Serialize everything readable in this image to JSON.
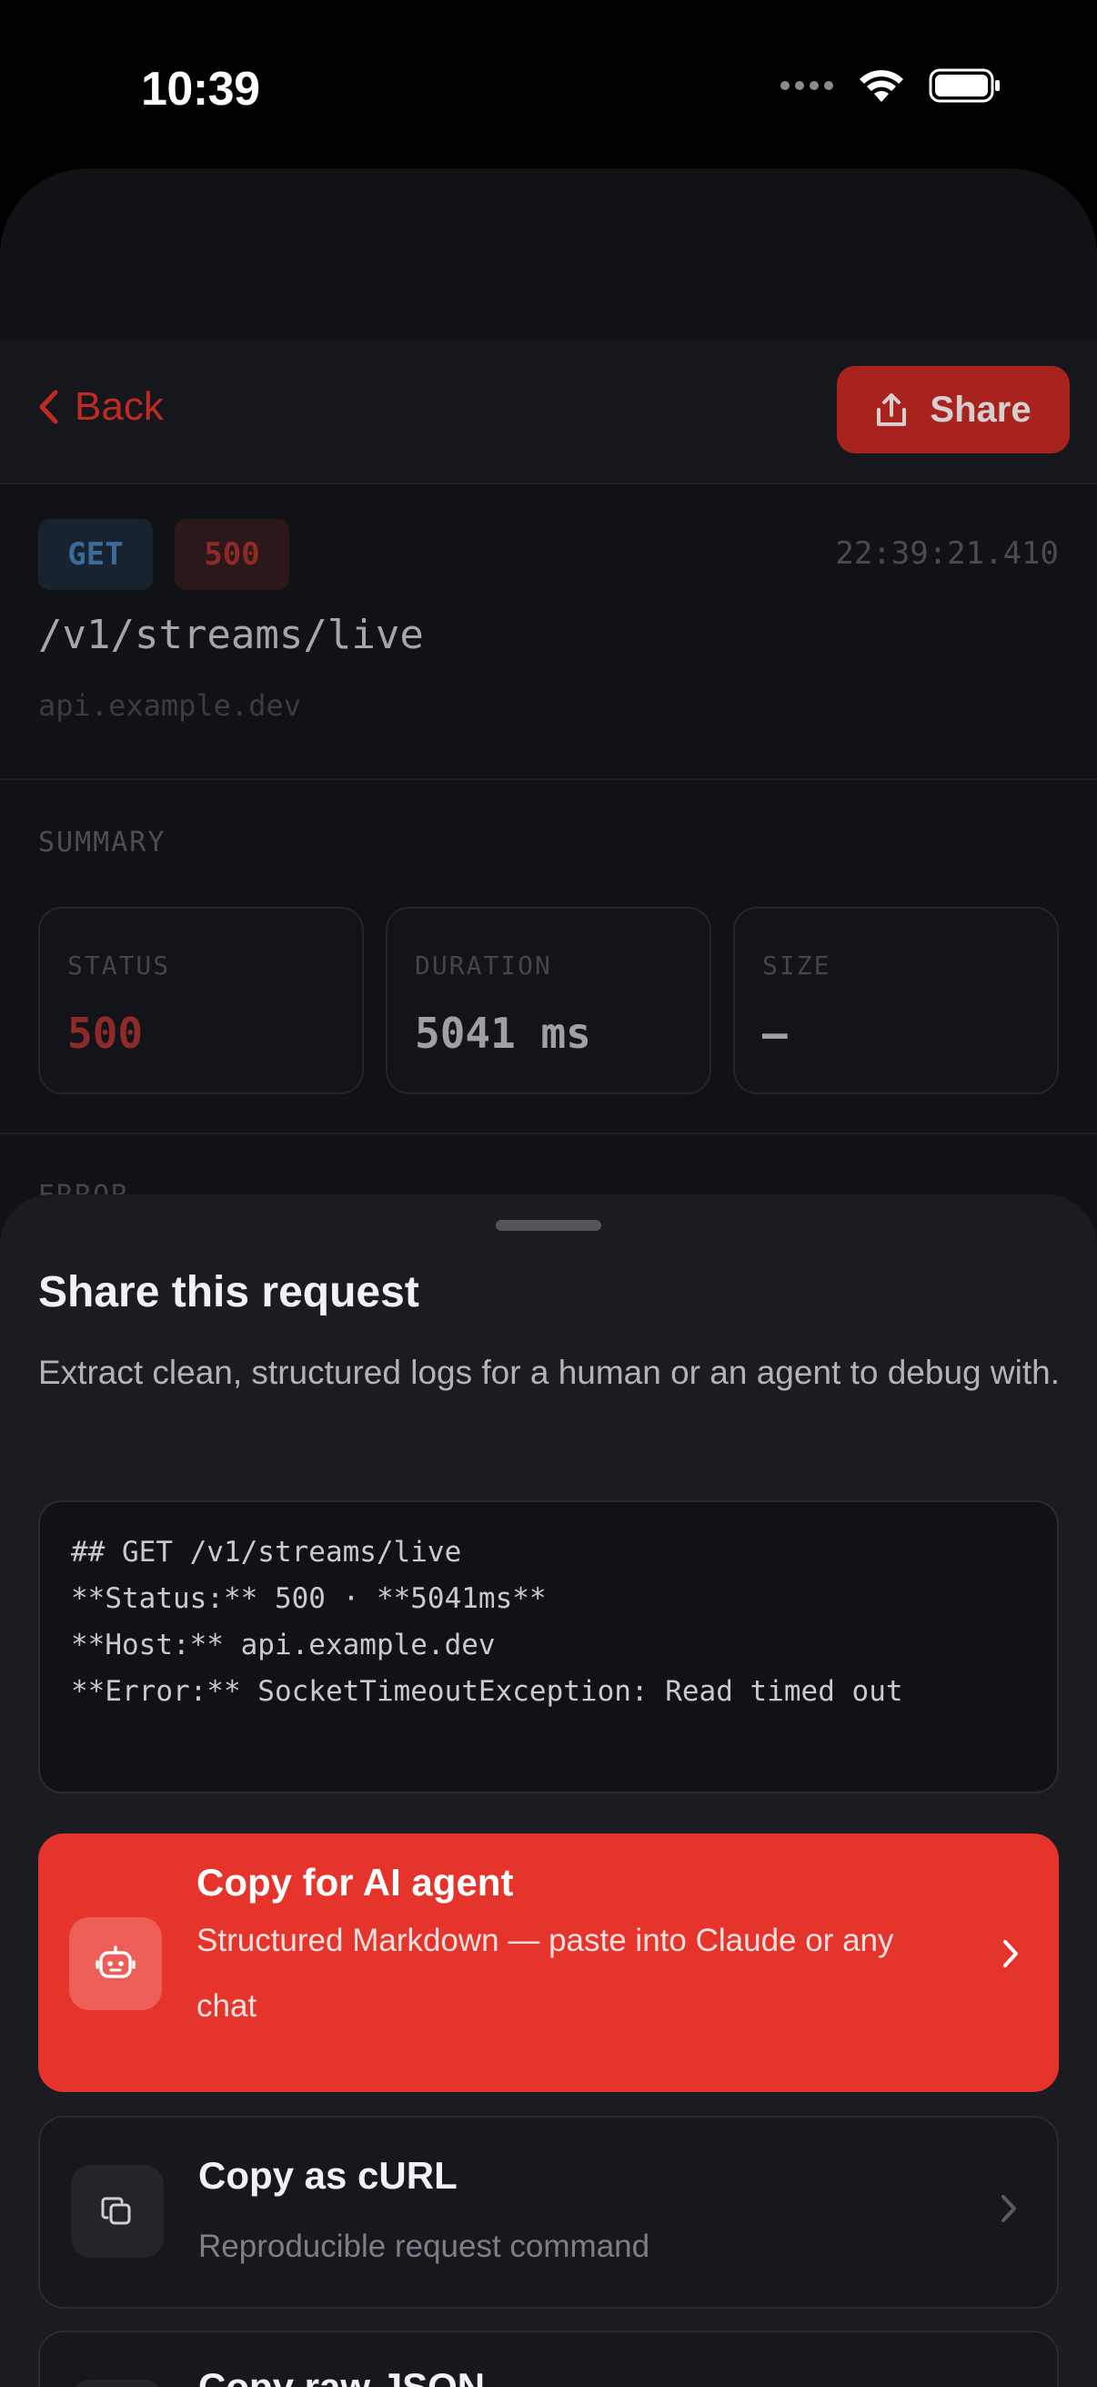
{
  "status_bar": {
    "time": "10:39"
  },
  "nav": {
    "back_label": "Back",
    "share_label": "Share"
  },
  "request": {
    "method": "GET",
    "status": "500",
    "timestamp": "22:39:21.410",
    "path": "/v1/streams/live",
    "host": "api.example.dev"
  },
  "summary": {
    "section_label": "SUMMARY",
    "status_label": "STATUS",
    "status_value": "500",
    "duration_label": "DURATION",
    "duration_value": "5041 ms",
    "size_label": "SIZE",
    "size_value": "—"
  },
  "error_section_label": "ERROR",
  "sheet": {
    "title": "Share this request",
    "description": "Extract clean, structured logs for a human or an agent to debug with.",
    "preview_lines": [
      "## GET /v1/streams/live",
      "**Status:** 500 · **5041ms**",
      "**Host:** api.example.dev",
      "**Error:** SocketTimeoutException: Read timed out"
    ],
    "actions": [
      {
        "title": "Copy for AI agent",
        "subtitle": "Structured Markdown — paste into Claude or any chat",
        "icon": "robot-icon"
      },
      {
        "title": "Copy as cURL",
        "subtitle": "Reproducible request command",
        "icon": "copy-icon"
      },
      {
        "title": "Copy raw JSON",
        "subtitle": "",
        "icon": "code-icon"
      }
    ]
  },
  "colors": {
    "accent": "#e5342b",
    "background": "#111216",
    "sheet": "#1b1c21"
  }
}
